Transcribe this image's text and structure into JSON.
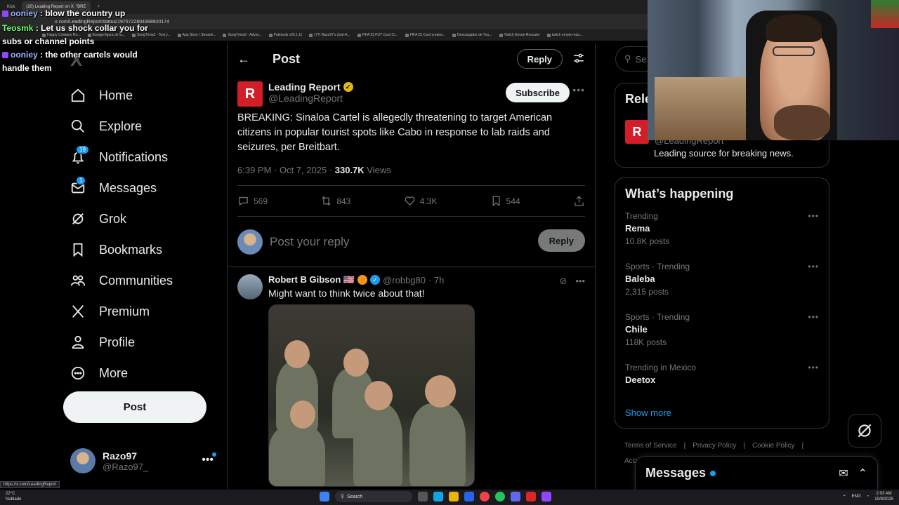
{
  "browser": {
    "tabs": [
      {
        "label": "Kick",
        "active": false
      },
      {
        "label": "(20) Leading Report on X: \"BRE",
        "active": true
      }
    ],
    "url": "x.com/LeadingReport/status/1975722804398920174",
    "bookmarks": [
      "Happy Cristiano Ro...",
      "Burago figura de la...",
      "SongTrivia2 - Test y...",
      "App Store / Streami...",
      "SongTrivia2 - Advivi...",
      "Paletools v25.1.11",
      "(77) Razo97's Zest-A...",
      "FIFA 23 FUT Card Cr...",
      "FIFA 23 Card creator...",
      "Descargador de You...",
      "Twitch Emote Rescaler",
      "twitch emote resiz..."
    ],
    "status_url": "https://x.com/LeadingReport"
  },
  "chat": [
    {
      "user": "ooniey",
      "text": ": blow the country up",
      "color": "#9bb3ff"
    },
    {
      "user": "Teosmk",
      "text": ": Let us shock collar you for subs or channel points",
      "color": "#6fff6f"
    },
    {
      "user": "ooniey",
      "text": ": the other cartels would handle them",
      "color": "#9bb3ff"
    }
  ],
  "nav": {
    "logo": "X",
    "items": [
      {
        "label": "Home",
        "icon": "home-icon"
      },
      {
        "label": "Explore",
        "icon": "search-icon"
      },
      {
        "label": "Notifications",
        "icon": "bell-icon",
        "badge": "19"
      },
      {
        "label": "Messages",
        "icon": "mail-icon",
        "badge": "1"
      },
      {
        "label": "Grok",
        "icon": "grok-icon"
      },
      {
        "label": "Bookmarks",
        "icon": "bookmark-icon"
      },
      {
        "label": "Communities",
        "icon": "people-icon"
      },
      {
        "label": "Premium",
        "icon": "x-icon"
      },
      {
        "label": "Profile",
        "icon": "person-icon"
      },
      {
        "label": "More",
        "icon": "more-circle-icon"
      }
    ],
    "post_label": "Post",
    "account": {
      "name": "Razo97",
      "handle": "@Razo97_"
    }
  },
  "main": {
    "title": "Post",
    "reply_label": "Reply",
    "tweet": {
      "author": "Leading Report",
      "handle": "@LeadingReport",
      "subscribe_label": "Subscribe",
      "text": "BREAKING: Sinaloa Cartel is allegedly threatening to target American citizens in popular tourist spots like Cabo in response to lab raids and seizures, per Breitbart.",
      "time": "6:39 PM · Oct 7, 2025 ·",
      "views": "330.7K",
      "views_label": "Views",
      "replies": "569",
      "reposts": "843",
      "likes": "4.3K",
      "bookmarks": "544"
    },
    "reply_box": {
      "placeholder": "Post your reply",
      "button": "Reply"
    },
    "comment": {
      "name": "Robert B Gibson 🇺🇸",
      "handle": "@robbg80",
      "time": "· 7h",
      "text": "Might want to think twice about that!"
    }
  },
  "right": {
    "search_placeholder": "Se",
    "relevant": {
      "title": "Rele",
      "handle": "@LeadingReport",
      "bio": "Leading source for breaking news."
    },
    "trends_title": "What’s happening",
    "trends": [
      {
        "context": "Trending",
        "name": "Rema",
        "count": "10.8K posts"
      },
      {
        "context": "Sports · Trending",
        "name": "Baleba",
        "count": "2,315 posts"
      },
      {
        "context": "Sports · Trending",
        "name": "Chile",
        "count": "118K posts"
      },
      {
        "context": "Trending in Mexico",
        "name": "Deetox",
        "count": ""
      }
    ],
    "show_more": "Show more",
    "footer": [
      "Terms of Service",
      "Privacy Policy",
      "Cookie Policy"
    ],
    "footer2": "Acce",
    "messages_label": "Messages"
  },
  "taskbar": {
    "weather_temp": "22°C",
    "weather_desc": "Nublado",
    "search": "Search",
    "lang": "ENG",
    "time": "2:03 AM",
    "date": "10/8/2025"
  }
}
